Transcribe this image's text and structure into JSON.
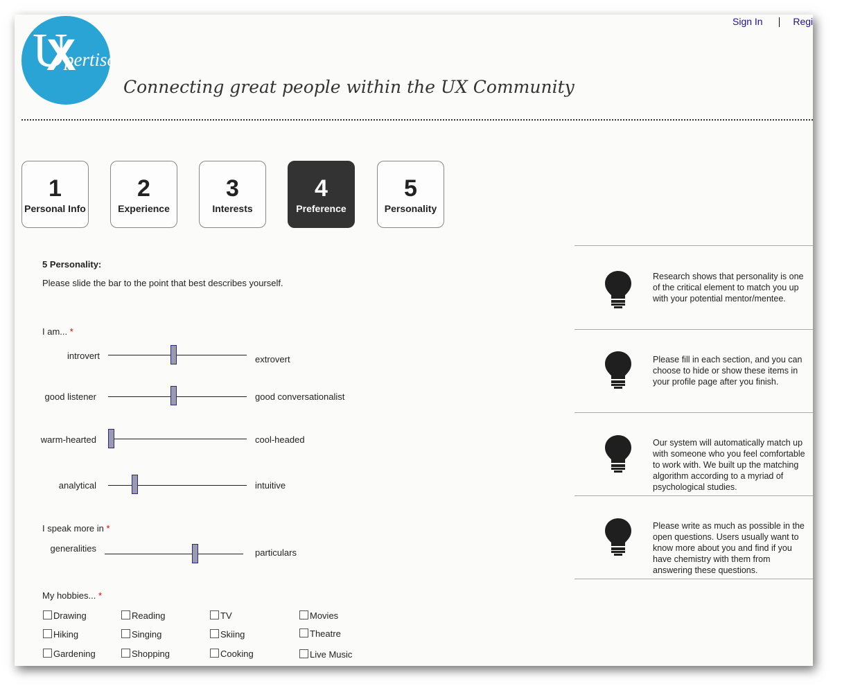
{
  "header": {
    "logo_letters": "UX",
    "logo_word": "pertise",
    "tagline": "Connecting great people within the UX Community",
    "sign_in": "Sign In",
    "register": "Registe"
  },
  "steps": [
    {
      "number": "1",
      "label": "Personal Info",
      "active": false
    },
    {
      "number": "2",
      "label": "Experience",
      "active": false
    },
    {
      "number": "3",
      "label": "Interests",
      "active": false
    },
    {
      "number": "4",
      "label": "Preference",
      "active": true
    },
    {
      "number": "5",
      "label": "Personality",
      "active": false
    }
  ],
  "form": {
    "section_title": "5 Personality:",
    "instructions": "Please slide the bar to the point that best describes yourself.",
    "required_mark": "*",
    "i_am_label": "I am...",
    "sliders_i_am": [
      {
        "left": "introvert",
        "right": "extrovert",
        "value": 0.48
      },
      {
        "left": "good listener",
        "right": "good conversationalist",
        "value": 0.48
      },
      {
        "left": "warm-hearted",
        "right": "cool-headed",
        "value": 0.0
      },
      {
        "left": "analytical",
        "right": "intuitive",
        "value": 0.18
      }
    ],
    "speak_label": "I speak more in",
    "slider_speak": {
      "left": "generalities",
      "right": "particulars",
      "value": 0.67
    },
    "hobbies_label": "My hobbies...",
    "hobbies": [
      [
        "Drawing",
        "Reading",
        "TV",
        "Movies"
      ],
      [
        "Hiking",
        "Singing",
        "Skiing",
        "Theatre"
      ],
      [
        "Gardening",
        "Shopping",
        "Cooking",
        "Live Music"
      ]
    ]
  },
  "tips": [
    {
      "icon": "lightbulb-icon",
      "text": "Research shows that personality is one of the critical element to match you up with your potential mentor/mentee."
    },
    {
      "icon": "lightbulb-icon",
      "text": "Please fill in each section, and you can choose to hide or show these items in your profile page after you finish."
    },
    {
      "icon": "lightbulb-icon",
      "text": "Our system will automatically match up with someone who you feel comfortable to work with. We built up the matching algorithm according to a myriad of psychological studies."
    },
    {
      "icon": "lightbulb-icon",
      "text": "Please write as much as possible in the open questions. Users usually want to know more about you and find if you have chemistry with them from answering these questions."
    }
  ],
  "colors": {
    "logo_blue": "#2aa4d4",
    "active_step": "#333333",
    "link": "#1a0dab",
    "required": "#dd0000",
    "slider_thumb": "#9a9ab0"
  }
}
